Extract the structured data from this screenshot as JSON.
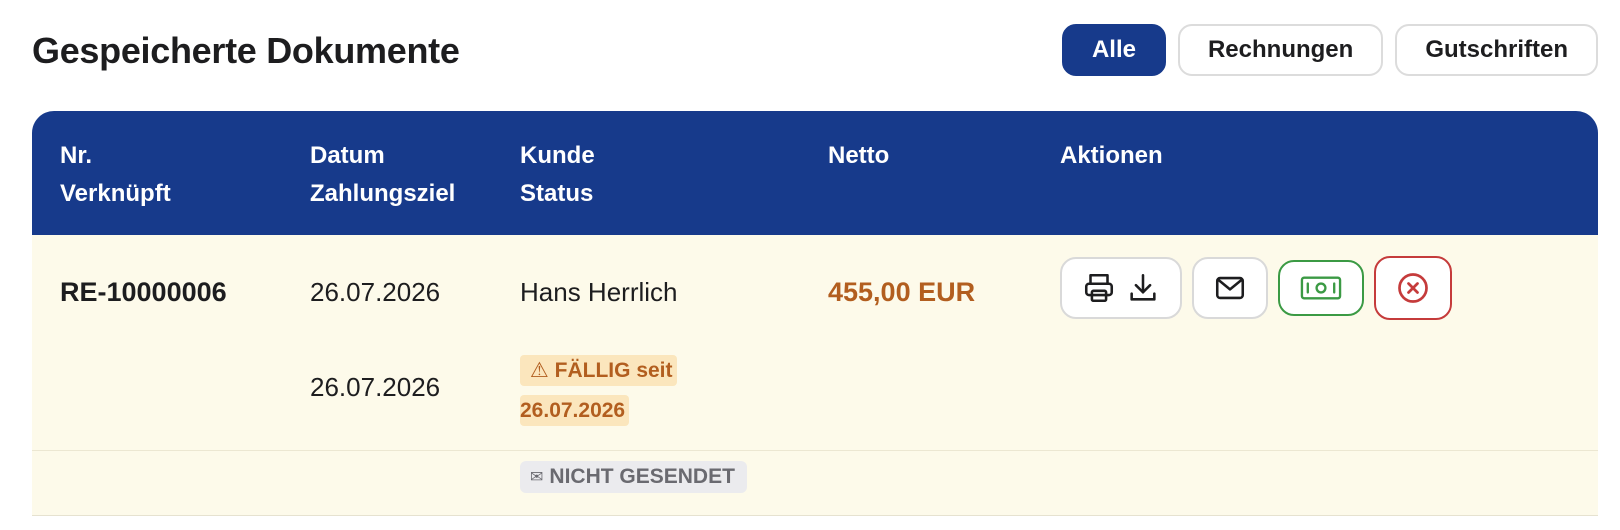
{
  "header": {
    "title": "Gespeicherte Dokumente",
    "filters": [
      {
        "label": "Alle",
        "active": true
      },
      {
        "label": "Rechnungen",
        "active": false
      },
      {
        "label": "Gutschriften",
        "active": false
      }
    ]
  },
  "table": {
    "columns": [
      {
        "line1": "Nr.",
        "line2": "Verknüpft"
      },
      {
        "line1": "Datum",
        "line2": "Zahlungsziel"
      },
      {
        "line1": "Kunde",
        "line2": "Status"
      },
      {
        "line1": "Netto",
        "line2": ""
      },
      {
        "line1": "Aktionen",
        "line2": ""
      }
    ],
    "rows": [
      {
        "number": "RE-10000006",
        "date": "26.07.2026",
        "due_date": "26.07.2026",
        "customer": "Hans Herrlich",
        "net": "455,00 EUR",
        "status_due_prefix": "⚠ FÄLLIG seit",
        "status_due_date": "26.07.2026",
        "send_status_icon": "✉",
        "send_status": "NICHT GESENDET",
        "actions": [
          {
            "name": "print-download",
            "icons": [
              "printer-icon",
              "download-icon"
            ]
          },
          {
            "name": "email",
            "icons": [
              "mail-icon"
            ]
          },
          {
            "name": "payment",
            "icons": [
              "banknote-icon"
            ],
            "color": "#3b9a44"
          },
          {
            "name": "cancel",
            "icons": [
              "x-circle-icon"
            ],
            "color": "#c53b3b"
          }
        ]
      }
    ]
  },
  "colors": {
    "primary": "#173a8b",
    "row_background": "#fdfaea",
    "amount": "#b25e1f",
    "due_badge_bg": "#fbe6bd",
    "success": "#3b9a44",
    "danger": "#c53b3b"
  }
}
